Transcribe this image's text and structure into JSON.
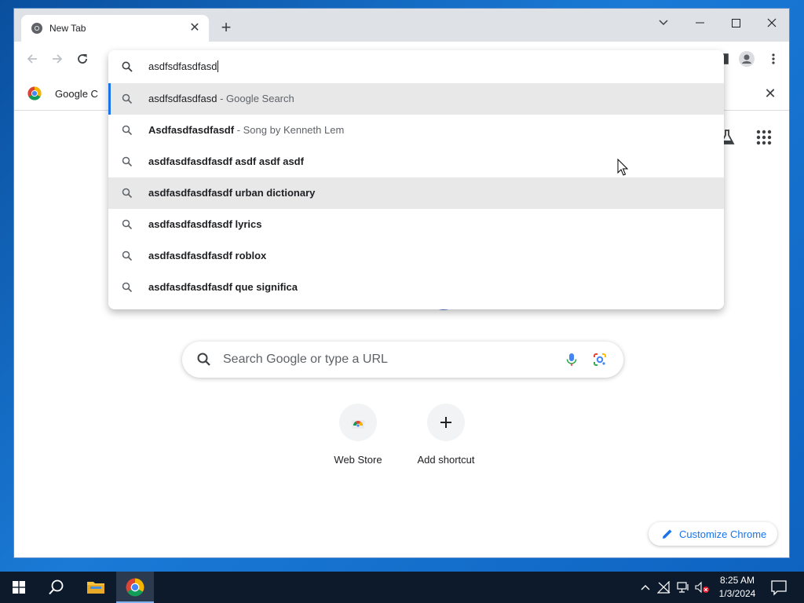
{
  "browser": {
    "tab_title": "New Tab",
    "bookmark_label": "Google C"
  },
  "omnibox": {
    "query": "asdfsdfasdfasd",
    "suggestions": [
      {
        "main": "asdfsdfasdfasd",
        "sub": " - Google Search",
        "selected": true
      },
      {
        "main": "Asdfasdfasdfasdf",
        "sub": " - Song by Kenneth Lem",
        "selected": false
      },
      {
        "main": "asdfasdfasdfasdf asdf asdf asdf",
        "sub": "",
        "selected": false
      },
      {
        "main": "asdfasdfasdfasdf urban dictionary",
        "sub": "",
        "selected": false,
        "hovered": true
      },
      {
        "main": "asdfasdfasdfasdf lyrics",
        "sub": "",
        "selected": false
      },
      {
        "main": "asdfasdfasdfasdf roblox",
        "sub": "",
        "selected": false
      },
      {
        "main": "asdfasdfasdfasdf que significa",
        "sub": "",
        "selected": false
      }
    ]
  },
  "ntp": {
    "search_placeholder": "Search Google or type a URL",
    "shortcuts": [
      {
        "label": "Web Store",
        "icon": "webstore-icon"
      },
      {
        "label": "Add shortcut",
        "icon": "plus-icon"
      }
    ],
    "customize_label": "Customize Chrome"
  },
  "taskbar": {
    "time": "8:25 AM",
    "date": "1/3/2024"
  },
  "colors": {
    "accent": "#1a73e8",
    "tab_strip": "#dee1e6",
    "taskbar": "#0d1a2b"
  }
}
